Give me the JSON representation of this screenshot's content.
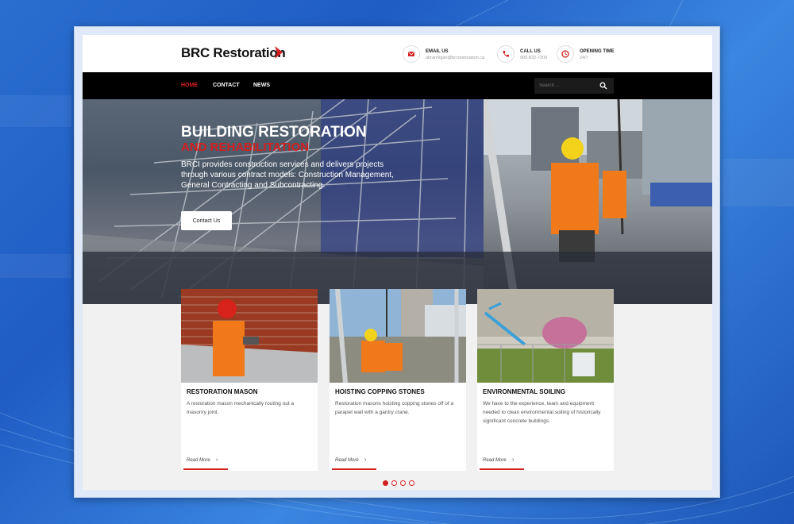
{
  "brand": {
    "name": "BRC Restoration",
    "accent": "#d21f1f"
  },
  "header": {
    "email": {
      "title": "EMAIL US",
      "value": "abrannigan@brcrestoration.ca"
    },
    "call": {
      "title": "CALL US",
      "value": "905-832-7200"
    },
    "hours": {
      "title": "OPENING TIME",
      "value": "24/7"
    }
  },
  "nav": {
    "items": [
      {
        "label": "HOME",
        "active": true
      },
      {
        "label": "CONTACT",
        "active": false
      },
      {
        "label": "NEWS",
        "active": false
      }
    ],
    "search_placeholder": "Search ..."
  },
  "hero": {
    "title": "BUILDING RESTORATION",
    "subtitle": "AND REHABILITATION",
    "text": "BRCI provides construction services and delivers projects through various contract models: Construction Management, General Contracting and Subcontracting.",
    "button": "Contact Us"
  },
  "cards": [
    {
      "title": "RESTORATION MASON",
      "desc": "A restoration mason mechanically routing out a masonry joint.",
      "more": "Read More"
    },
    {
      "title": "HOISTING COPPING STONES",
      "desc": "Restoration masons hoisting copping stones off of a parapet wall with a gantry crane.",
      "more": "Read More"
    },
    {
      "title": "ENVIRONMENTAL SOILING",
      "desc": "We have to the experience, team and equipment needed to clean environmental soiling of historically significant concrete buildings.",
      "more": "Read More"
    }
  ],
  "slider": {
    "count": 4,
    "active": 1
  }
}
